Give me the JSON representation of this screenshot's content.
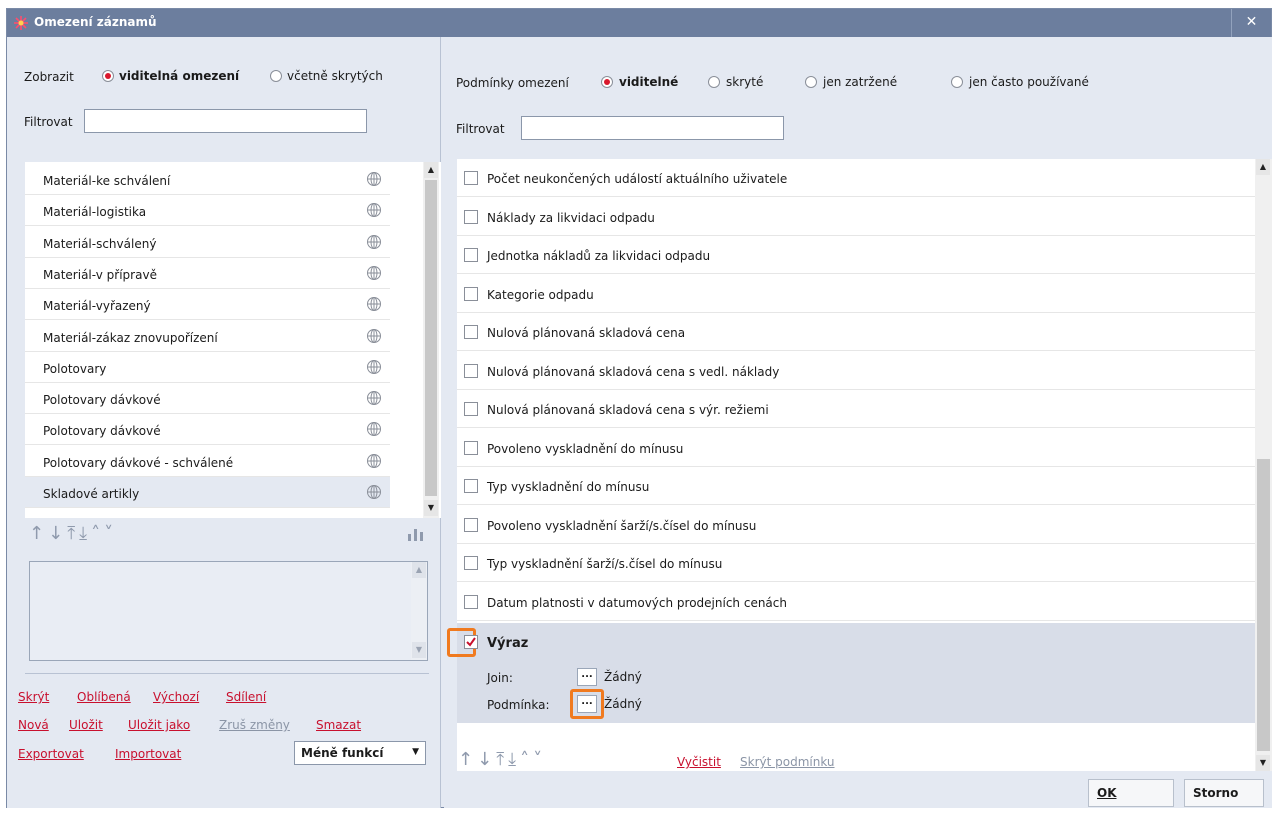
{
  "window": {
    "title": "Omezení záznamů",
    "close_label": "✕"
  },
  "left": {
    "show_label": "Zobrazit",
    "radio_visible": "viditelná omezení",
    "radio_hidden": "včetně skrytých",
    "filter_label": "Filtrovat",
    "filter_value": "",
    "items": [
      {
        "label": "Materiál-ke schválení",
        "icon": "globe-icon"
      },
      {
        "label": "Materiál-logistika",
        "icon": "globe-icon"
      },
      {
        "label": "Materiál-schválený",
        "icon": "globe-icon"
      },
      {
        "label": "Materiál-v přípravě",
        "icon": "globe-icon"
      },
      {
        "label": "Materiál-vyřazený",
        "icon": "globe-icon"
      },
      {
        "label": "Materiál-zákaz znovupořízení",
        "icon": "globe-icon"
      },
      {
        "label": "Polotovary",
        "icon": "globe-icon"
      },
      {
        "label": "Polotovary dávkové",
        "icon": "globe-icon"
      },
      {
        "label": "Polotovary dávkové",
        "icon": "globe-icon"
      },
      {
        "label": "Polotovary dávkové - schválené",
        "icon": "globe-icon"
      },
      {
        "label": "Skladové artikly",
        "icon": "globe-icon"
      }
    ],
    "arrows": "↑ ↓ ⤒ ⤓ ^ ˅",
    "links_row1": [
      "Skrýt",
      "Oblíbená",
      "Výchozí",
      "Sdílení"
    ],
    "links_row2": [
      "Nová",
      "Uložit",
      "Uložit jako",
      "Zruš změny",
      "Smazat"
    ],
    "links_row3": [
      "Exportovat",
      "Importovat"
    ],
    "combo_value": "Méně funkcí"
  },
  "right": {
    "conditions_label": "Podmínky omezení",
    "radio_visible": "viditelné",
    "radio_hidden": "skryté",
    "radio_checked": "jen zatržené",
    "radio_frequent": "jen často používané",
    "filter_label": "Filtrovat",
    "filter_value": "",
    "conditions": [
      "Počet neukončených událostí aktuálního uživatele",
      "Náklady za likvidaci odpadu",
      "Jednotka nákladů za likvidaci odpadu",
      "Kategorie odpadu",
      "Nulová plánovaná skladová cena",
      "Nulová plánovaná skladová cena s vedl. náklady",
      "Nulová plánovaná skladová cena s výr. režiemi",
      "Povoleno vyskladnění do mínusu",
      "Typ vyskladnění do mínusu",
      "Povoleno vyskladnění šarží/s.čísel do mínusu",
      "Typ vyskladnění šarží/s.čísel do mínusu",
      "Datum platnosti v datumových prodejních cenách"
    ],
    "expression": {
      "label": "Výraz",
      "join_label": "Join:",
      "join_value": "Žádný",
      "condition_label": "Podmínka:",
      "condition_value": "Žádný",
      "dots": "..."
    },
    "clear_link": "Vyčistit",
    "hide_link": "Skrýt podmínku",
    "ok_label": "OK",
    "cancel_label": "Storno"
  },
  "colors": {
    "accent": "#d9182d",
    "highlight": "#f07a1f",
    "titlebar": "#6c7e9e",
    "panel": "#e4e9f2"
  }
}
